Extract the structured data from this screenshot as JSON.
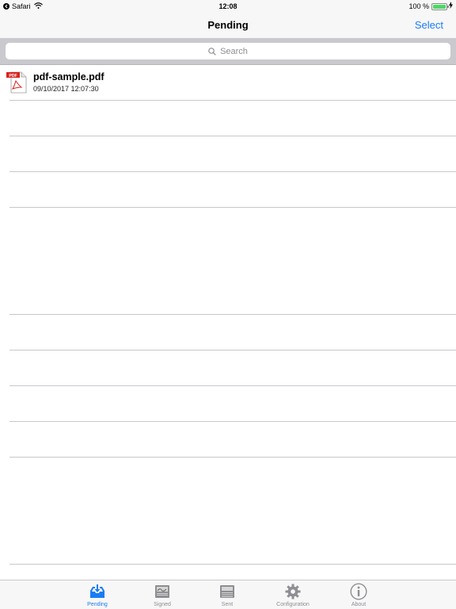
{
  "status_bar": {
    "back_app": "Safari",
    "time": "12:08",
    "battery_percent": "100 %",
    "battery_level": 1.0
  },
  "nav": {
    "title": "Pending",
    "select_label": "Select"
  },
  "search": {
    "placeholder": "Search"
  },
  "files": [
    {
      "name": "pdf-sample.pdf",
      "date": "09/10/2017 12:07:30",
      "icon": "pdf-file-icon",
      "badge": "PDF"
    }
  ],
  "tabs": [
    {
      "label": "Pending",
      "icon": "inbox-download-icon",
      "active": true
    },
    {
      "label": "Signed",
      "icon": "signed-tray-icon",
      "active": false
    },
    {
      "label": "Sent",
      "icon": "sent-tray-icon",
      "active": false
    },
    {
      "label": "Configuration",
      "icon": "gear-icon",
      "active": false
    },
    {
      "label": "About",
      "icon": "info-icon",
      "active": false
    }
  ],
  "colors": {
    "accent": "#1a7cf5",
    "inactive": "#8e8e93",
    "battery": "#4cd964",
    "pdf_red": "#d9211d"
  }
}
